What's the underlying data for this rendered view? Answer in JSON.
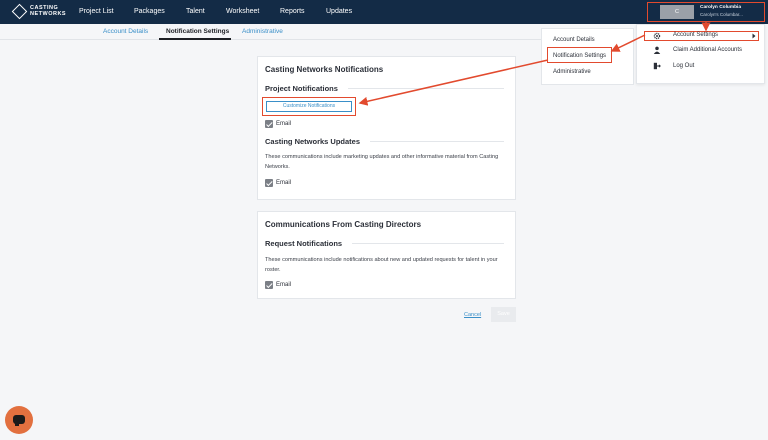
{
  "brand": {
    "line1": "CASTING",
    "line2": "NETWORKS"
  },
  "nav": [
    "Project List",
    "Packages",
    "Talent",
    "Worksheet",
    "Reports",
    "Updates"
  ],
  "user": {
    "initial": "C",
    "name": "Carolyn Columbia",
    "subtitle": "Carolyn's Columbar..."
  },
  "subtabs": [
    "Account Details",
    "Notification Settings",
    "Administrative"
  ],
  "card1": {
    "title": "Casting Networks Notifications",
    "project_title": "Project Notifications",
    "customize_label": "Customize Notifications",
    "email_label_1": "Email",
    "updates_title": "Casting Networks Updates",
    "updates_desc": "These communications include marketing updates and other informative material from Casting Networks.",
    "email_label_2": "Email"
  },
  "card2": {
    "title": "Communications From Casting Directors",
    "request_title": "Request Notifications",
    "request_desc": "These communications include notifications about new and updated requests for talent in your roster.",
    "email_label": "Email"
  },
  "actions": {
    "cancel": "Cancel",
    "save": "Save"
  },
  "dropdown": {
    "account_settings": "Account Settings",
    "claim": "Claim Additional Accounts",
    "logout": "Log Out"
  },
  "submenu": [
    "Account Details",
    "Notification Settings",
    "Administrative"
  ],
  "colors": {
    "nav_bg": "#132b46",
    "accent": "#3a8fc8",
    "highlight": "#e24a2e",
    "chat": "#e2703f"
  }
}
